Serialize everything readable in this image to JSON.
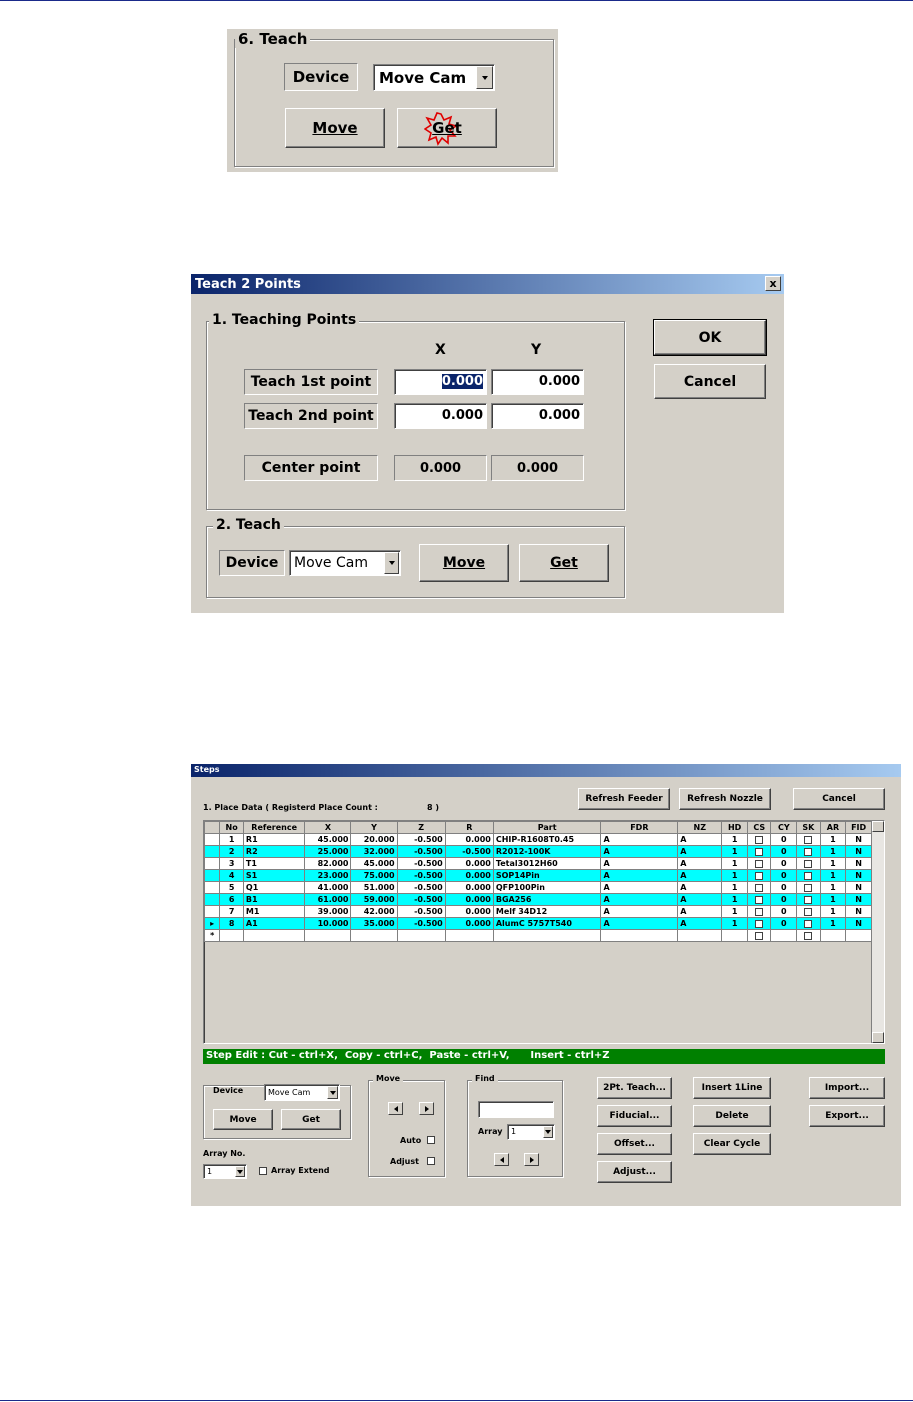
{
  "teach_panel": {
    "group_title": "6. Teach",
    "device_label": "Device",
    "device_value": "Move Cam",
    "move_button": "Move",
    "get_button": "Get"
  },
  "teach2_dialog": {
    "title": "Teach 2 Points",
    "close_glyph": "x",
    "group1_title": "1. Teaching Points",
    "col_x": "X",
    "col_y": "Y",
    "row1_label": "Teach 1st point",
    "row1_x": "0.000",
    "row1_y": "0.000",
    "row2_label": "Teach 2nd point",
    "row2_x": "0.000",
    "row2_y": "0.000",
    "center_label": "Center point",
    "center_x": "0.000",
    "center_y": "0.000",
    "ok_button": "OK",
    "cancel_button": "Cancel",
    "group2_title": "2. Teach",
    "device_label": "Device",
    "device_value": "Move Cam",
    "move_button": "Move",
    "get_button": "Get"
  },
  "steps_window": {
    "title": "Steps",
    "place_data_label": "1. Place Data ( Registerd Place Count :",
    "place_count": "8 )",
    "refresh_feeder": "Refresh Feeder",
    "refresh_nozzle": "Refresh Nozzle",
    "cancel": "Cancel",
    "columns": [
      "No",
      "Reference",
      "X",
      "Y",
      "Z",
      "R",
      "Part",
      "FDR",
      "NZ",
      "HD",
      "CS",
      "CY",
      "SK",
      "AR",
      "FID"
    ],
    "rows": [
      {
        "no": "1",
        "ref": "R1",
        "x": "45.000",
        "y": "20.000",
        "z": "-0.500",
        "r": "0.000",
        "part": "CHIP-R1608T0.45",
        "fdr": "A",
        "nz": "A",
        "hd": "1",
        "cy": "0",
        "ar": "1",
        "fid": "N"
      },
      {
        "no": "2",
        "ref": "R2",
        "x": "25.000",
        "y": "32.000",
        "z": "-0.500",
        "r": "-0.500",
        "part": "R2012-100K",
        "fdr": "A",
        "nz": "A",
        "hd": "1",
        "cy": "0",
        "ar": "1",
        "fid": "N"
      },
      {
        "no": "3",
        "ref": "T1",
        "x": "82.000",
        "y": "45.000",
        "z": "-0.500",
        "r": "0.000",
        "part": "Tetal3012H60",
        "fdr": "A",
        "nz": "A",
        "hd": "1",
        "cy": "0",
        "ar": "1",
        "fid": "N"
      },
      {
        "no": "4",
        "ref": "S1",
        "x": "23.000",
        "y": "75.000",
        "z": "-0.500",
        "r": "0.000",
        "part": "SOP14Pin",
        "fdr": "A",
        "nz": "A",
        "hd": "1",
        "cy": "0",
        "ar": "1",
        "fid": "N"
      },
      {
        "no": "5",
        "ref": "Q1",
        "x": "41.000",
        "y": "51.000",
        "z": "-0.500",
        "r": "0.000",
        "part": "QFP100Pin",
        "fdr": "A",
        "nz": "A",
        "hd": "1",
        "cy": "0",
        "ar": "1",
        "fid": "N"
      },
      {
        "no": "6",
        "ref": "B1",
        "x": "61.000",
        "y": "59.000",
        "z": "-0.500",
        "r": "0.000",
        "part": "BGA256",
        "fdr": "A",
        "nz": "A",
        "hd": "1",
        "cy": "0",
        "ar": "1",
        "fid": "N"
      },
      {
        "no": "7",
        "ref": "M1",
        "x": "39.000",
        "y": "42.000",
        "z": "-0.500",
        "r": "0.000",
        "part": "Melf 34D12",
        "fdr": "A",
        "nz": "A",
        "hd": "1",
        "cy": "0",
        "ar": "1",
        "fid": "N"
      },
      {
        "no": "8",
        "ref": "A1",
        "x": "10.000",
        "y": "35.000",
        "z": "-0.500",
        "r": "0.000",
        "part": "AlumC 5757T540",
        "fdr": "A",
        "nz": "A",
        "hd": "1",
        "cy": "0",
        "ar": "1",
        "fid": "N"
      }
    ],
    "step_edit_bar": "Step Edit : Cut - ctrl+X,  Copy - ctrl+C,  Paste - ctrl+V,      Insert - ctrl+Z",
    "device_label": "Device",
    "device_value": "Move Cam",
    "move_button": "Move",
    "get_button": "Get",
    "move_group": "Move",
    "auto_label": "Auto",
    "adjust_label": "Adjust",
    "find_group": "Find",
    "array_label": "Array",
    "array_value": "1",
    "array_no_label": "Array No.",
    "array_no_value": "1",
    "array_extend_label": "Array Extend",
    "btn_2pt_teach": "2Pt. Teach...",
    "btn_fiducial": "Fiducial...",
    "btn_offset": "Offset...",
    "btn_adjust": "Adjust...",
    "btn_insert_line": "Insert 1Line",
    "btn_delete": "Delete",
    "btn_clear_cycle": "Clear Cycle",
    "btn_import": "Import...",
    "btn_export": "Export..."
  },
  "colors": {
    "rule": "#1a2a8a",
    "panel_gray": "#d4d0c8",
    "row_highlight": "#00ffff",
    "status_green": "#008000",
    "title_blue": "#0a246a"
  }
}
